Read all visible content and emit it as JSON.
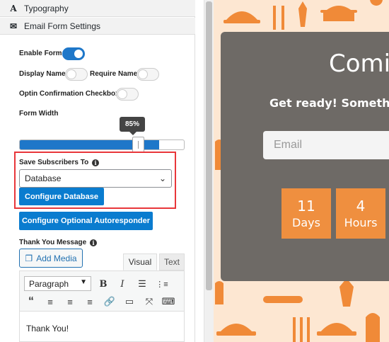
{
  "sections": {
    "typography": "Typography",
    "email_form_settings": "Email Form Settings"
  },
  "form": {
    "enable_form": {
      "label": "Enable Form",
      "on": true
    },
    "display_name": {
      "label": "Display Name",
      "on": false
    },
    "require_name": {
      "label": "Require Name",
      "on": false
    },
    "optin_checkbox": {
      "label": "Optin Confirmation Checkbox",
      "on": false
    },
    "form_width": {
      "label": "Form Width",
      "value_label": "85%",
      "value": 0.85
    },
    "save_subscribers": {
      "label": "Save Subscribers To",
      "selected": "Database"
    },
    "configure_database": "Configure Database",
    "configure_autoresponder": "Configure Optional Autoresponder",
    "thank_you": {
      "label": "Thank You Message",
      "add_media": "Add Media",
      "tab_visual": "Visual",
      "tab_text": "Text",
      "format": "Paragraph",
      "content": "Thank You!"
    }
  },
  "preview": {
    "title": "Comin",
    "subtitle": "Get ready! Somethin",
    "email_placeholder": "Email",
    "countdown": [
      {
        "value": "11",
        "unit": "Days"
      },
      {
        "value": "4",
        "unit": "Hours"
      }
    ]
  },
  "colors": {
    "accent": "#0a7ccf",
    "highlight": "#e8363a",
    "preview_bg": "#fde7d2",
    "card": "#6e6a66",
    "countdown": "#ef8f3f"
  }
}
